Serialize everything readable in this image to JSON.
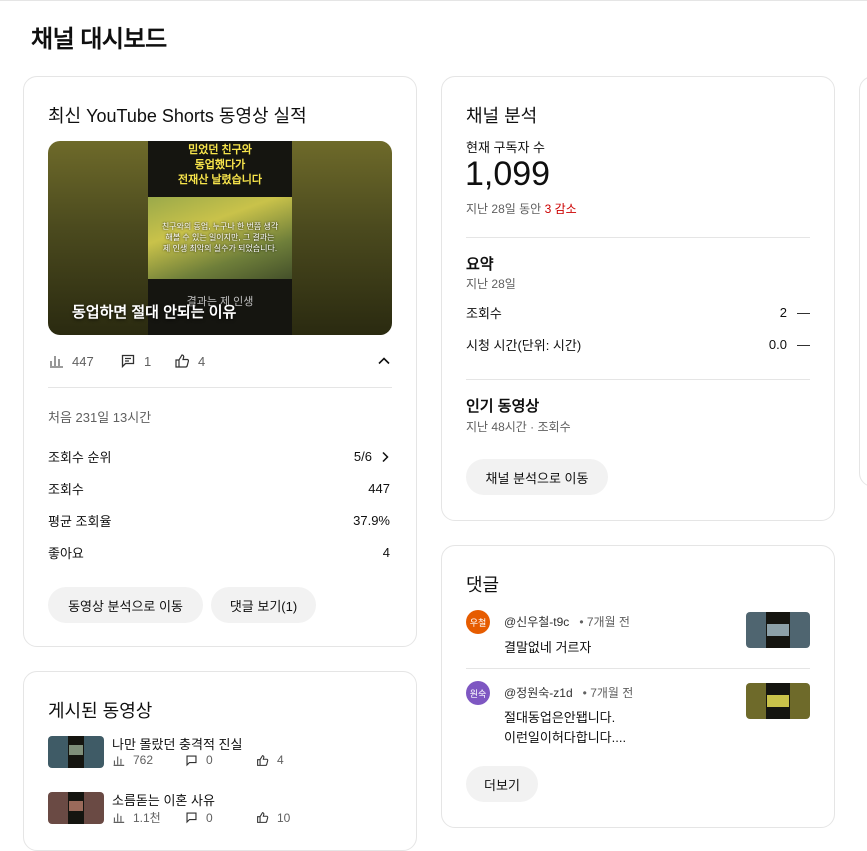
{
  "page": {
    "title": "채널 대시보드"
  },
  "colors": {
    "decline": "#cc0000",
    "pill_bg": "#f2f2f2",
    "avatar1": "#e65c00",
    "avatar2": "#7e57c2"
  },
  "shorts_card": {
    "title": "최신 YouTube Shorts 동영상 실적",
    "thumbnail": {
      "headline": "믿었던 친구와\n동업했다가\n전재산 날렸습니다",
      "body": "친구와의 동업, 누구나 한 번쯤 생각\n해볼 수 있는 일이지만, 그 결과는\n제 인생 최악의 실수가 되었습니다.",
      "footer": "결과는 제 인생",
      "caption": "동업하면 절대 안되는 이유"
    },
    "stats": {
      "views": "447",
      "comments": "1",
      "likes": "4"
    },
    "first_period": "처음 231일 13시간",
    "rows": [
      {
        "label": "조회수 순위",
        "value": "5/6"
      },
      {
        "label": "조회수",
        "value": "447"
      },
      {
        "label": "평균 조회율",
        "value": "37.9%"
      },
      {
        "label": "좋아요",
        "value": "4"
      }
    ],
    "btn_analytics": "동영상 분석으로 이동",
    "btn_comments": "댓글 보기(1)"
  },
  "analytics_card": {
    "title": "채널 분석",
    "subs_label": "현재 구독자 수",
    "subs_value": "1,099",
    "subs_change_prefix": "지난 28일 동안 ",
    "subs_change": "3 감소",
    "summary_title": "요약",
    "summary_period": "지난 28일",
    "rows": [
      {
        "label": "조회수",
        "value": "2",
        "trend": "—"
      },
      {
        "label": "시청 시간(단위: 시간)",
        "value": "0.0",
        "trend": "—"
      }
    ],
    "popular_title": "인기 동영상",
    "popular_sub": "지난 48시간 · 조회수",
    "btn": "채널 분석으로 이동"
  },
  "published_card": {
    "title": "게시된 동영상",
    "videos": [
      {
        "title": "나만 몰랐던 충격적 진실",
        "views": "762",
        "comments": "0",
        "likes": "4"
      },
      {
        "title": "소름돋는 이혼 사유",
        "views": "1.1천",
        "comments": "0",
        "likes": "10"
      }
    ]
  },
  "comments_card": {
    "title": "댓글",
    "comments": [
      {
        "avatar": "우철",
        "author": "@신우철-t9c",
        "time": "• 7개월 전",
        "text": "결말없네 거르자"
      },
      {
        "avatar": "원숙",
        "author": "@정원숙-z1d",
        "time": "• 7개월 전",
        "text": "절대동업은안됍니다.\n이런일이허다합니다...."
      }
    ],
    "btn_more": "더보기"
  }
}
